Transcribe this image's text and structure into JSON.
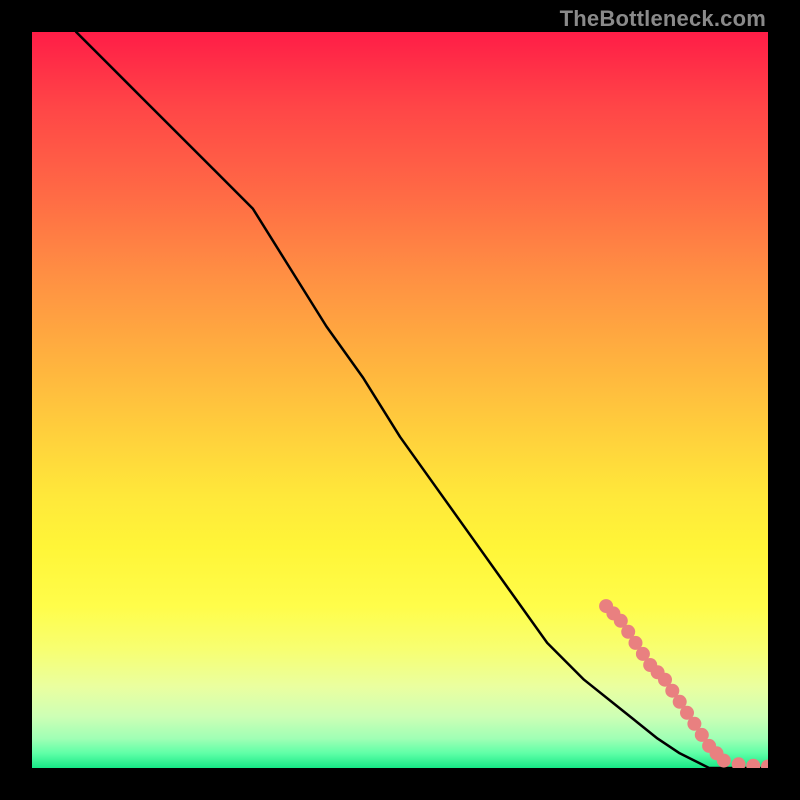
{
  "watermark": "TheBottleneck.com",
  "colors": {
    "background": "#000000",
    "gradient_top": "#ff1d47",
    "gradient_bottom": "#17e886",
    "line": "#000000",
    "marker_fill": "#e98080",
    "marker_stroke": "#d06a6a"
  },
  "chart_data": {
    "type": "line",
    "title": "",
    "xlabel": "",
    "ylabel": "",
    "xlim": [
      0,
      100
    ],
    "ylim": [
      0,
      100
    ],
    "grid": false,
    "legend": false,
    "series": [
      {
        "name": "curve",
        "x": [
          6,
          10,
          15,
          20,
          25,
          30,
          35,
          40,
          45,
          50,
          55,
          60,
          65,
          70,
          75,
          80,
          85,
          88,
          90,
          92,
          94,
          96,
          98,
          100
        ],
        "y": [
          100,
          96,
          91,
          86,
          81,
          76,
          68,
          60,
          53,
          45,
          38,
          31,
          24,
          17,
          12,
          8,
          4,
          2,
          1,
          0,
          0,
          0,
          0,
          0
        ]
      },
      {
        "name": "markers",
        "type": "scatter",
        "x": [
          78,
          79,
          80,
          81,
          82,
          83,
          84,
          85,
          86,
          87,
          88,
          89,
          90,
          91,
          92,
          93,
          94,
          96,
          98,
          100
        ],
        "y": [
          22,
          21,
          20,
          18.5,
          17,
          15.5,
          14,
          13,
          12,
          10.5,
          9,
          7.5,
          6,
          4.5,
          3,
          2,
          1,
          0.5,
          0.3,
          0.2
        ]
      }
    ]
  }
}
